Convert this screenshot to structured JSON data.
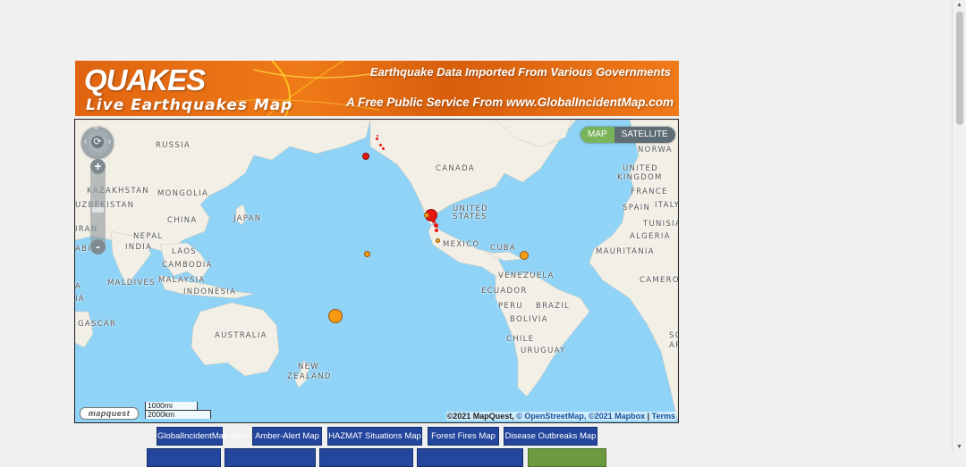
{
  "banner": {
    "title": "QUAKES",
    "subtitle": "Live Earthquakes Map",
    "tagline1": "Earthquake Data Imported From Various Governments",
    "tagline2": "A Free Public Service From www.GlobalIncidentMap.com"
  },
  "map": {
    "type_map": "MAP",
    "type_satellite": "SATELLITE",
    "compass_n": "N",
    "zoom_in": "+",
    "zoom_out": "-",
    "logo": "mapquest",
    "scale_mi": "1000mi",
    "scale_km": "2000km",
    "attribution": {
      "copyright": "©2021 MapQuest,",
      "osm": "© OpenStreetMap,",
      "mapbox": "©2021 Mapbox",
      "sep": " | ",
      "terms": "Terms"
    },
    "labels": {
      "russia": "RUSSIA",
      "kazakhstan": "KAZAKHSTAN",
      "mongolia": "MONGOLIA",
      "uzbekistan": "UZBEKISTAN",
      "china": "CHINA",
      "japan": "JAPAN",
      "nepal": "NEPAL",
      "iran": "IRAN",
      "arabia": "ABI",
      "india": "INDIA",
      "laos": "LAOS",
      "cambodia": "CAMBODIA",
      "maldives": "MALDIVES",
      "malaysia": "MALAYSIA",
      "indonesia": "INDONESIA",
      "madagascar": "GASCAR",
      "australia": "AUSTRALIA",
      "new": "NEW",
      "zealand": "ZEALAND",
      "canada": "CANADA",
      "united": "UNITED",
      "states": "STATES",
      "mexico": "MEXICO",
      "cuba": "CUBA",
      "venezuela": "VENEZUELA",
      "ecuador": "ECUADOR",
      "peru": "PERU",
      "brazil": "BRAZIL",
      "bolivia": "BOLIVIA",
      "chile": "CHILE",
      "uruguay": "URUGUAY",
      "norway": "NORWA",
      "uk1": "UNITED",
      "uk2": "KINGDOM",
      "france": "FRANCE",
      "spain": "SPAIN",
      "italy": "ITALY",
      "tunisia": "TUNISIA",
      "algeria": "ALGERIA",
      "mauritania": "MAURITANIA",
      "cameroon": "CAMERO",
      "a1": "A",
      "ia": "IA",
      "s1": "SC",
      "s2": "AF"
    }
  },
  "nav": {
    "row1": [
      "GlobalIncidentMap.com",
      "Amber-Alert Map",
      "HAZMAT Situations Map",
      "Forest Fires Map",
      "Disease Outbreaks Map"
    ]
  },
  "colors": {
    "banner": "#ef7a18",
    "ocean": "#8fd3f7",
    "land": "#f2efe6",
    "nav": "#24479d",
    "quake_orange": "#f59d14",
    "quake_red": "#e8180d"
  }
}
